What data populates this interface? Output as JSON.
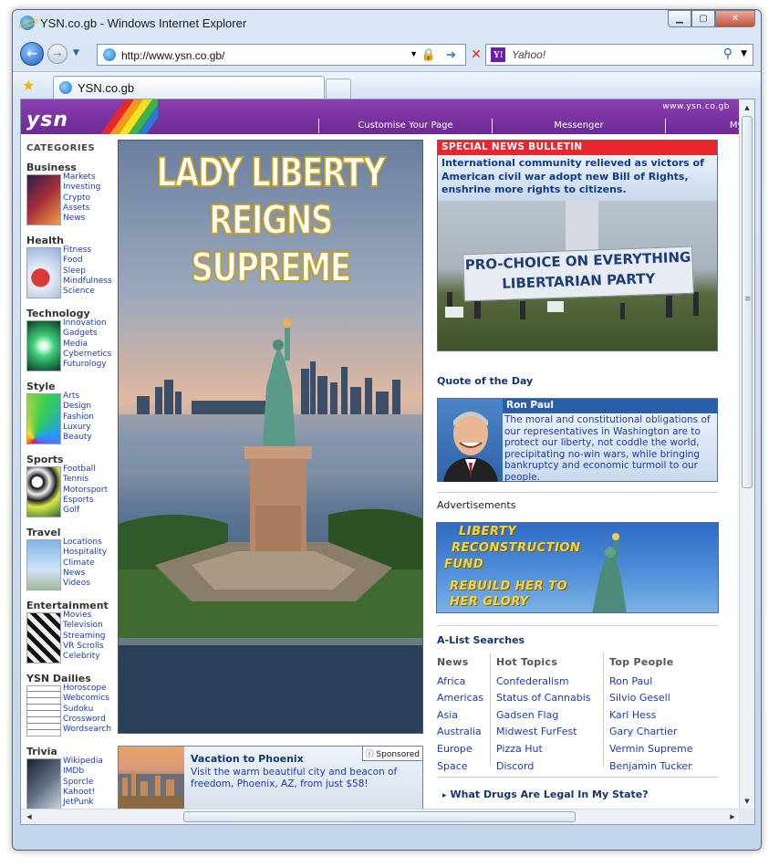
{
  "window": {
    "title": "YSN.co.gb - Windows Internet Explorer"
  },
  "addressbar": {
    "url": "http://www.ysn.co.gb/",
    "search_placeholder": "Yahoo!",
    "search_logo": "Y!"
  },
  "tabs": [
    {
      "label": "YSN.co.gb"
    }
  ],
  "header": {
    "logo": "ysn",
    "domain": "www.ysn.co.gb",
    "nav": [
      "Customise Your Page",
      "Messenger",
      "My D-Mail"
    ],
    "rainbow_colors": [
      "#e8262d",
      "#f39a1d",
      "#f4e21b",
      "#3fb24a",
      "#2a7bd1"
    ]
  },
  "sidebar": {
    "title": "CATEGORIES",
    "categories": [
      {
        "name": "Business",
        "links": [
          "Markets",
          "Investing",
          "Crypto",
          "Assets",
          "News"
        ]
      },
      {
        "name": "Health",
        "links": [
          "Fitness",
          "Food",
          "Sleep",
          "Mindfulness",
          "Science"
        ]
      },
      {
        "name": "Technology",
        "links": [
          "Innovation",
          "Gadgets",
          "Media",
          "Cybernetics",
          "Futurology"
        ]
      },
      {
        "name": "Style",
        "links": [
          "Arts",
          "Design",
          "Fashion",
          "Luxury",
          "Beauty"
        ]
      },
      {
        "name": "Sports",
        "links": [
          "Football",
          "Tennis",
          "Motorsport",
          "Esports",
          "Golf"
        ]
      },
      {
        "name": "Travel",
        "links": [
          "Locations",
          "Hospitality",
          "Climate",
          "News",
          "Videos"
        ]
      },
      {
        "name": "Entertainment",
        "links": [
          "Movies",
          "Television",
          "Streaming",
          "VR Scrolls",
          "Celebrity"
        ]
      },
      {
        "name": "YSN Dailies",
        "links": [
          "Horoscope",
          "Webcomics",
          "Sudoku",
          "Crossword",
          "Wordsearch"
        ]
      },
      {
        "name": "Trivia",
        "links": [
          "Wikipedia",
          "IMDb",
          "Sporcle",
          "Kahoot!",
          "JetPunk"
        ]
      }
    ]
  },
  "hero": {
    "headline_line1": "LADY LIBERTY",
    "headline_line2": "REIGNS SUPREME"
  },
  "sponsored_ad": {
    "badge": "Sponsored",
    "title": "Vacation to Phoenix",
    "text": "Visit the warm beautiful city and beacon of freedom, Phoenix, AZ, from just $58!"
  },
  "bulletin": {
    "heading": "SPECIAL NEWS BULLETIN",
    "text": "International community relieved as victors of American civil war adopt new Bill of Rights, enshrine more rights to citizens.",
    "banner_line1": "PRO-CHOICE ON EVERYTHING",
    "banner_line2": "LIBERTARIAN PARTY"
  },
  "quote": {
    "section_title": "Quote of the Day",
    "author": "Ron Paul",
    "text": "The moral and constitutional obligations of our representatives in Washington are to protect our liberty, not coddle the world, precipitating no-win wars, while bringing bankruptcy and economic turmoil to our people."
  },
  "ads": {
    "label": "Advertisements",
    "liberty_line1": "LIBERTY",
    "liberty_line2": "RECONSTRUCTION",
    "liberty_line3": "FUND",
    "liberty_line4": "REBUILD HER TO",
    "liberty_line5": "HER GLORY"
  },
  "searches": {
    "title": "A-List Searches",
    "columns": [
      {
        "heading": "News",
        "links": [
          "Africa",
          "Americas",
          "Asia",
          "Australia",
          "Europe",
          "Space"
        ]
      },
      {
        "heading": "Hot Topics",
        "links": [
          "Confederalism",
          "Status of Cannabis",
          "Gadsen Flag",
          "Midwest FurFest",
          "Pizza Hut",
          "Discord"
        ]
      },
      {
        "heading": "Top People",
        "links": [
          "Ron Paul",
          "Silvio Gesell",
          "Karl Hess",
          "Gary Chartier",
          "Vermin Supreme",
          "Benjamin Tucker"
        ]
      }
    ],
    "footer_link": "What Drugs Are Legal In My State?"
  }
}
